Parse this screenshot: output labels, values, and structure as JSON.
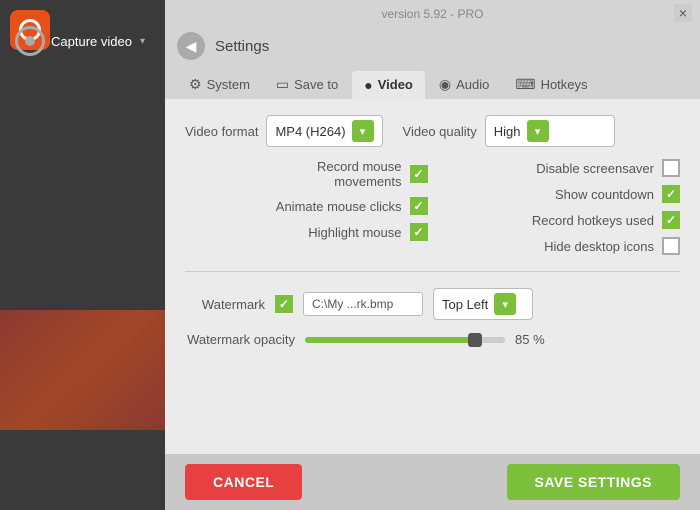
{
  "window": {
    "version": "version 5.92 - PRO",
    "close_label": "×"
  },
  "sidebar": {
    "capture_label": "Capture video",
    "chevron": "▾"
  },
  "header": {
    "back_icon": "◀",
    "title": "Settings"
  },
  "tabs": [
    {
      "id": "system",
      "label": "System",
      "icon": "⚙"
    },
    {
      "id": "saveto",
      "label": "Save to",
      "icon": "💾"
    },
    {
      "id": "video",
      "label": "Video",
      "icon": "●",
      "active": true
    },
    {
      "id": "audio",
      "label": "Audio",
      "icon": "🔊"
    },
    {
      "id": "hotkeys",
      "label": "Hotkeys",
      "icon": "⌨"
    }
  ],
  "video_settings": {
    "format_label": "Video format",
    "format_value": "MP4 (H264)",
    "quality_label": "Video quality",
    "quality_value": "High",
    "checkboxes": {
      "left": [
        {
          "id": "record_mouse",
          "label": "Record mouse movements",
          "checked": true
        },
        {
          "id": "animate_clicks",
          "label": "Animate mouse clicks",
          "checked": true
        },
        {
          "id": "highlight_mouse",
          "label": "Highlight mouse",
          "checked": true
        }
      ],
      "right": [
        {
          "id": "disable_screensaver",
          "label": "Disable screensaver",
          "checked": false
        },
        {
          "id": "show_countdown",
          "label": "Show countdown",
          "checked": true
        },
        {
          "id": "record_hotkeys",
          "label": "Record hotkeys used",
          "checked": true
        },
        {
          "id": "hide_desktop",
          "label": "Hide desktop icons",
          "checked": false
        }
      ]
    },
    "watermark_label": "Watermark",
    "watermark_checked": true,
    "watermark_path": "C:\\My ...rk.bmp",
    "watermark_position": "Top Left",
    "opacity_label": "Watermark opacity",
    "opacity_value": "85 %"
  },
  "footer": {
    "cancel_label": "CANCEL",
    "save_label": "SAVE SETTINGS"
  }
}
